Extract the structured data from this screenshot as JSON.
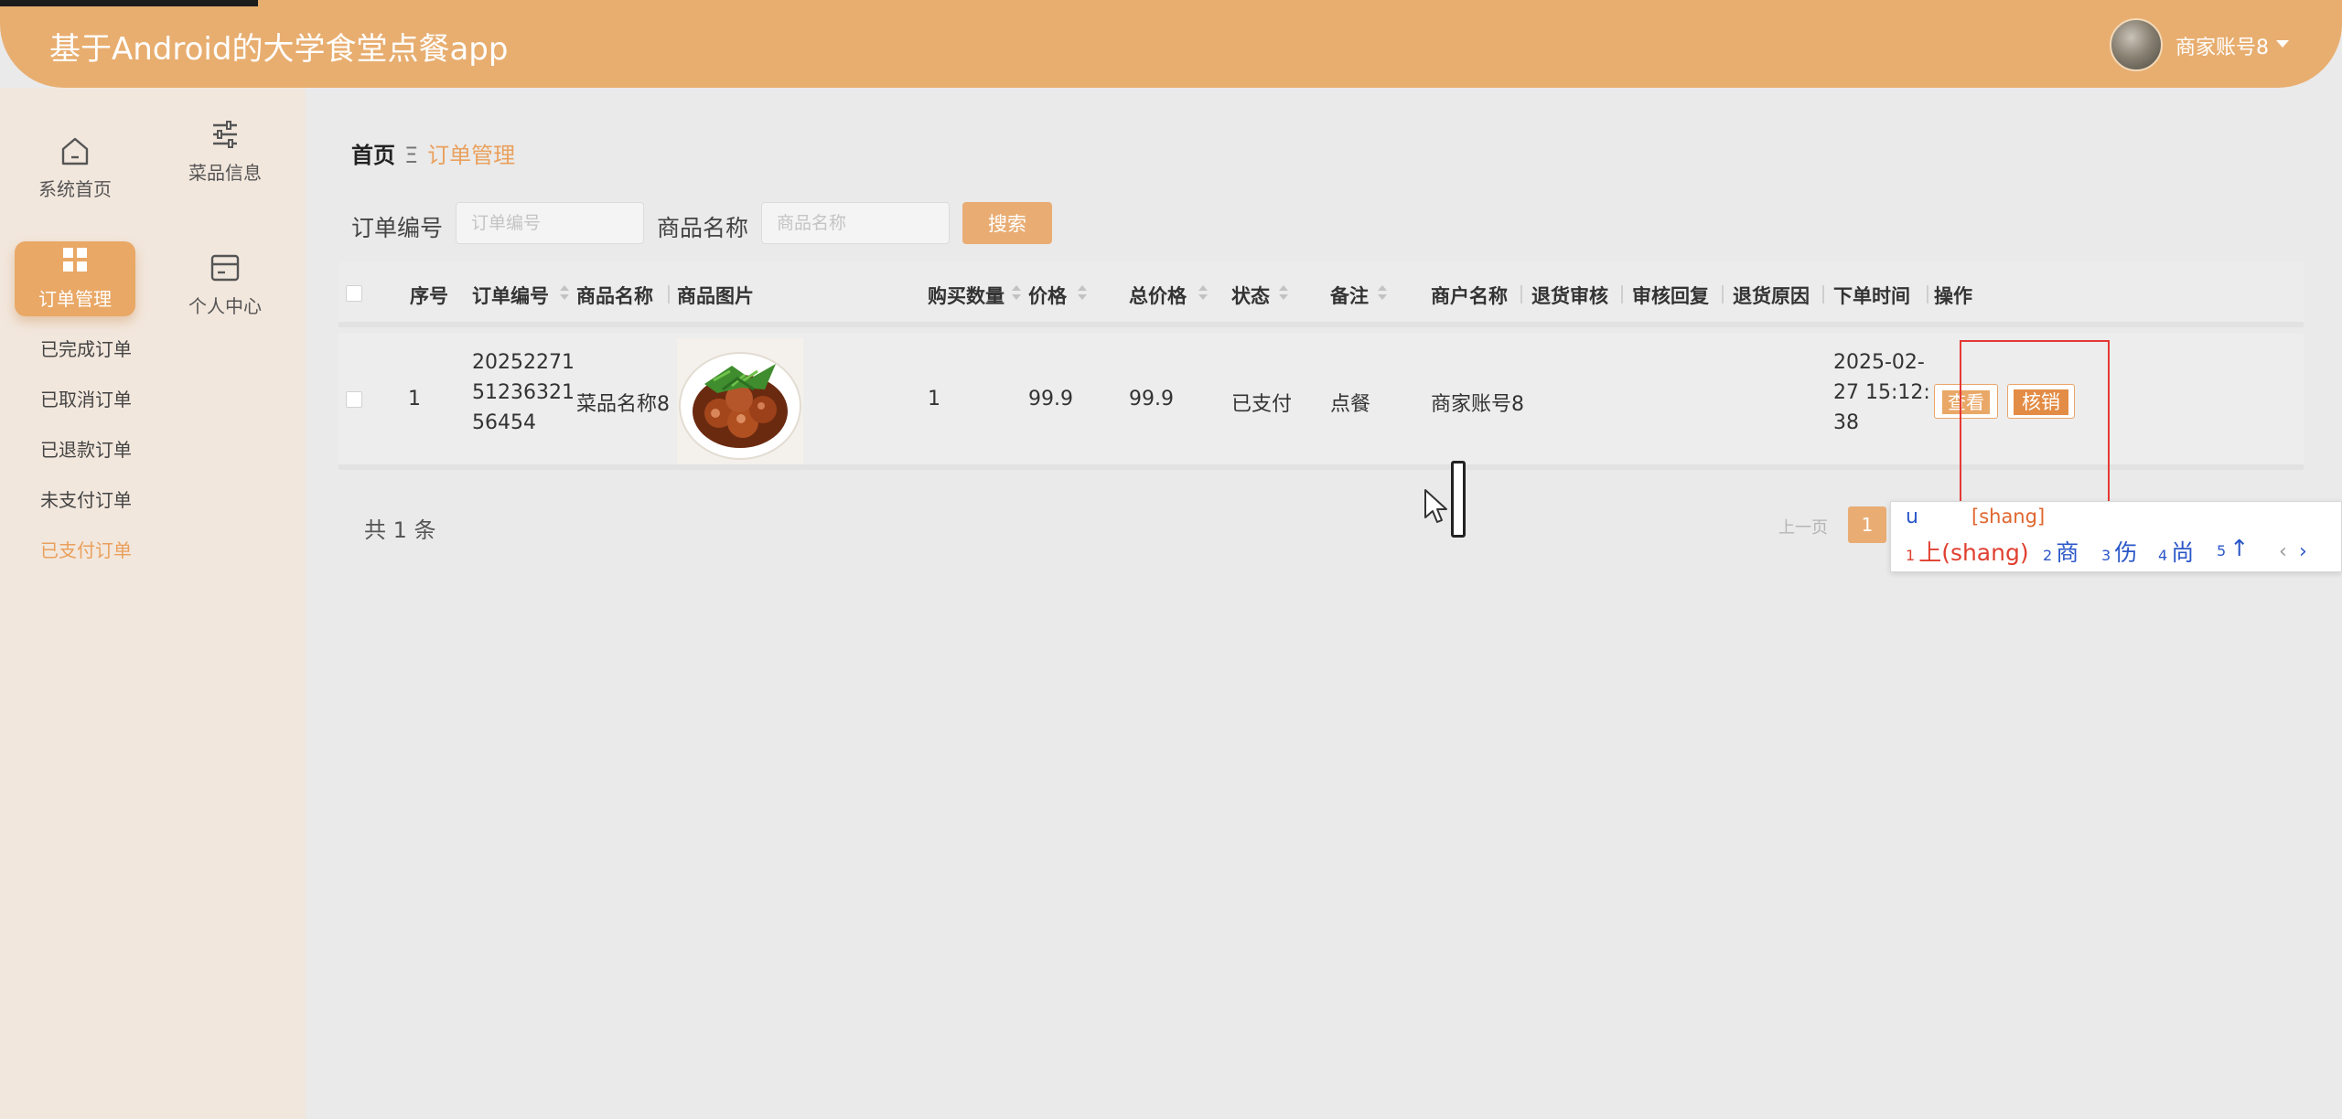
{
  "header": {
    "app_title": "基于Android的大学食堂点餐app",
    "user_name": "商家账号8"
  },
  "sidebar": {
    "nav": [
      {
        "label": "系统首页",
        "icon": "home-icon"
      },
      {
        "label": "菜品信息",
        "icon": "sliders-icon"
      },
      {
        "label": "订单管理",
        "icon": "grid-icon",
        "active": true
      },
      {
        "label": "个人中心",
        "icon": "card-icon"
      }
    ],
    "sub_items": [
      {
        "label": "已完成订单"
      },
      {
        "label": "已取消订单"
      },
      {
        "label": "已退款订单"
      },
      {
        "label": "未支付订单"
      },
      {
        "label": "已支付订单",
        "active": true
      }
    ]
  },
  "breadcrumb": {
    "home": "首页",
    "separator": "Ξ",
    "current": "订单管理"
  },
  "search": {
    "order_no_label": "订单编号",
    "order_no_placeholder": "订单编号",
    "product_label": "商品名称",
    "product_placeholder": "商品名称",
    "button_label": "搜索"
  },
  "table": {
    "headers": {
      "index": "序号",
      "order_no": "订单编号",
      "product_name": "商品名称",
      "product_image": "商品图片",
      "quantity": "购买数量",
      "price": "价格",
      "total_price": "总价格",
      "status": "状态",
      "remark": "备注",
      "merchant": "商户名称",
      "return_review": "退货审核",
      "review_reply": "审核回复",
      "return_reason": "退货原因",
      "order_time": "下单时间",
      "actions": "操作"
    },
    "rows": [
      {
        "index": "1",
        "order_no": "2025227151236321 56454",
        "order_no_lines": [
          "20252271",
          "51236321",
          "56454"
        ],
        "product_name": "菜品名称8",
        "quantity": "1",
        "price": "99.9",
        "total_price": "99.9",
        "status": "已支付",
        "remark": "点餐",
        "merchant": "商家账号8",
        "order_time_lines": [
          "2025-02-",
          "27 15:12:",
          "38"
        ],
        "view_label": "查看",
        "writeoff_label": "核销"
      }
    ]
  },
  "pagination": {
    "total_text": "共 1 条",
    "prev_label": "上一页",
    "current_page": "1"
  },
  "ime": {
    "input": "u",
    "pinyin": "[shang]",
    "candidates": [
      {
        "num": "1",
        "text": "上(shang)"
      },
      {
        "num": "2",
        "text": "商"
      },
      {
        "num": "3",
        "text": "伤"
      },
      {
        "num": "4",
        "text": "尚"
      },
      {
        "num": "5",
        "text": "↑"
      }
    ],
    "nav_prev": "‹",
    "nav_next": "›"
  },
  "colors": {
    "brand": "#e8ae70",
    "accent_text": "#e9a05c",
    "active_tile": "#e9a866",
    "writeoff_button": "#e38c45",
    "highlight_box": "#e53935"
  }
}
